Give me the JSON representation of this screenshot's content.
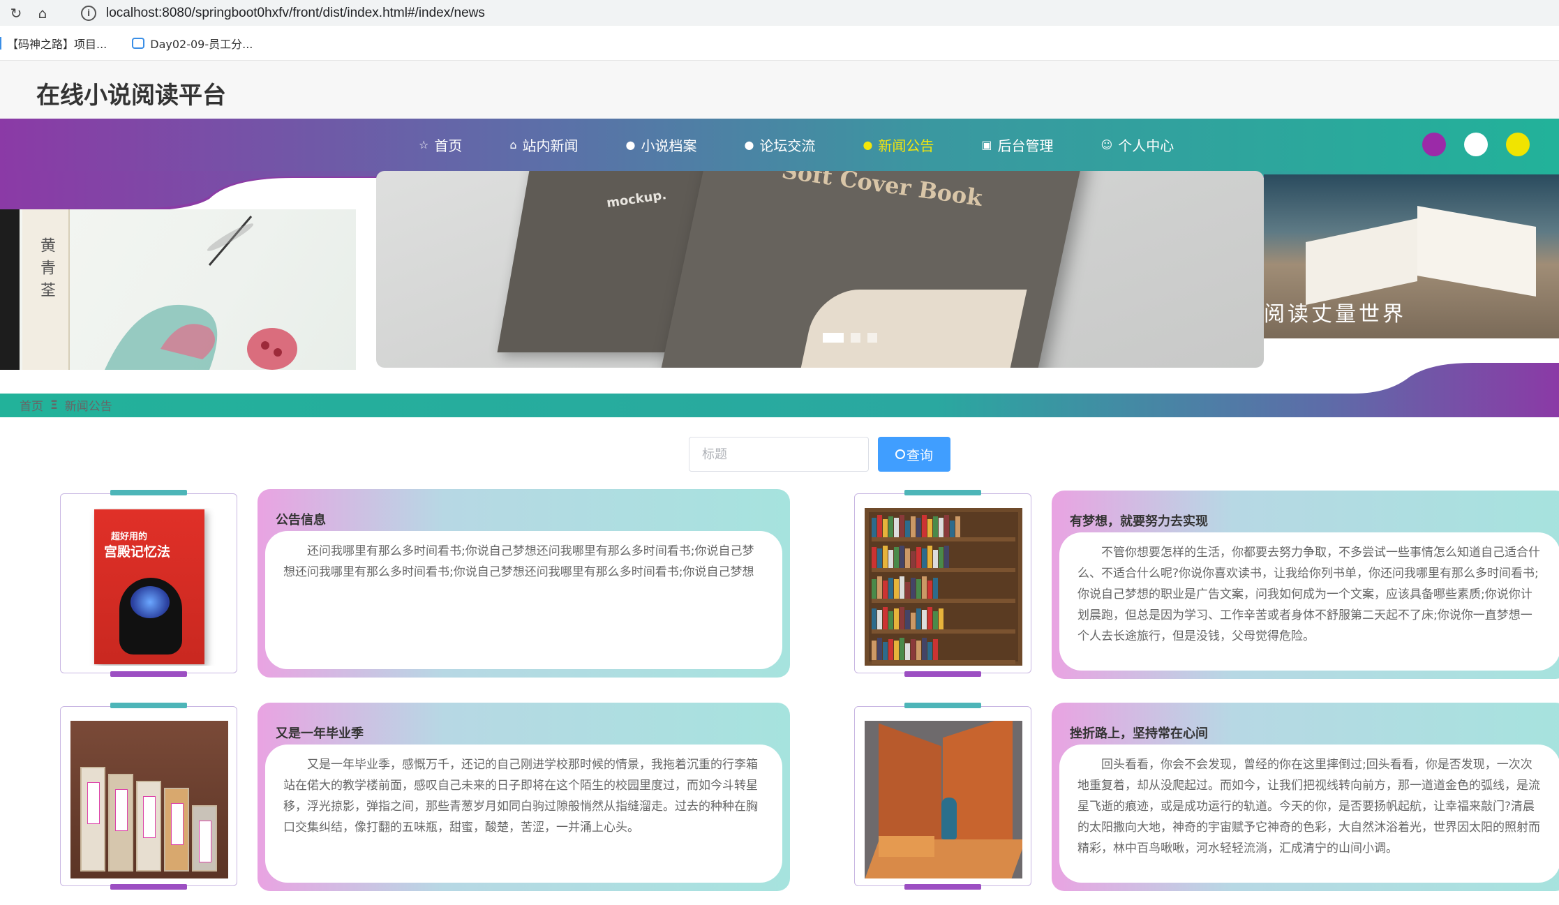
{
  "browser": {
    "url": "localhost:8080/springboot0hxfv/front/dist/index.html#/index/news",
    "bookmarks": [
      "【码神之路】项目...",
      "Day02-09-员工分..."
    ]
  },
  "site": {
    "title": "在线小说阅读平台"
  },
  "nav": {
    "items": [
      {
        "label": "首页",
        "icon": "star-icon"
      },
      {
        "label": "站内新闻",
        "icon": "bag-icon"
      },
      {
        "label": "小说档案",
        "icon": "info-icon"
      },
      {
        "label": "论坛交流",
        "icon": "question-icon"
      },
      {
        "label": "新闻公告",
        "icon": "info-icon",
        "active": true
      },
      {
        "label": "后台管理",
        "icon": "calendar-icon"
      },
      {
        "label": "个人中心",
        "icon": "user-icon"
      }
    ],
    "active_color": "#f4e70b",
    "theme_dots": [
      "#9b2aa8",
      "#ffffff",
      "#f1e400"
    ]
  },
  "banner": {
    "left_text": "黄青荃",
    "center_title": "Soft Cover Book",
    "center_small": "mockup.",
    "right_text": "阅读丈量世界",
    "slides": 3,
    "active_slide": 1
  },
  "breadcrumb": {
    "home": "首页",
    "separator": "Ξ",
    "current": "新闻公告"
  },
  "search": {
    "placeholder": "标题",
    "button_label": "查询"
  },
  "news": [
    {
      "title": "公告信息",
      "body": "还问我哪里有那么多时间看书;你说自己梦想还问我哪里有那么多时间看书;你说自己梦想还问我哪里有那么多时间看书;你说自己梦想还问我哪里有那么多时间看书;你说自己梦想"
    },
    {
      "title": "有梦想，就要努力去实现",
      "body": "不管你想要怎样的生活，你都要去努力争取，不多尝试一些事情怎么知道自己适合什么、不适合什么呢?你说你喜欢读书，让我给你列书单，你还问我哪里有那么多时间看书;你说自己梦想的职业是广告文案，问我如何成为一个文案，应该具备哪些素质;你说你计划晨跑，但总是因为学习、工作辛苦或者身体不舒服第二天起不了床;你说你一直梦想一个人去长途旅行，但是没钱，父母觉得危险。"
    },
    {
      "title": "又是一年毕业季",
      "body": "又是一年毕业季，感慨万千，还记的自己刚进学校那时候的情景，我拖着沉重的行李箱站在偌大的教学楼前面，感叹自己未来的日子即将在这个陌生的校园里度过，而如今斗转星移，浮光掠影，弹指之间，那些青葱岁月如同白驹过隙般悄然从指缝溜走。过去的种种在胸口交集纠结，像打翻的五味瓶，甜蜜，酸楚，苦涩，一并涌上心头。"
    },
    {
      "title": "挫折路上，坚持常在心间",
      "body": "回头看看，你会不会发现，曾经的你在这里摔倒过;回头看看，你是否发现，一次次地重复着，却从没爬起过。而如今，让我们把视线转向前方，那一道道金色的弧线，是流星飞逝的痕迹，或是成功运行的轨道。今天的你，是否要扬帆起航，让幸福来敲门?清晨的太阳撒向大地，神奇的宇宙赋予它神奇的色彩，大自然沐浴着光，世界因太阳的照射而精彩，林中百鸟啾啾，河水轻轻流淌，汇成清宁的山间小调。"
    }
  ],
  "thumbs": {
    "book_cover_title": "超好用的",
    "book_cover_main": "宫殿记忆法"
  }
}
